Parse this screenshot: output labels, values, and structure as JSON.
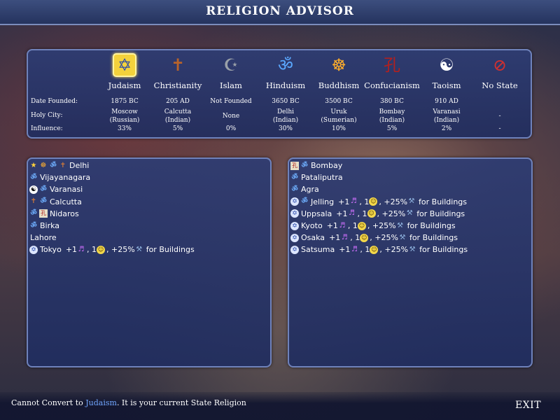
{
  "title": "RELIGION ADVISOR",
  "row_labels": {
    "date_founded": "Date Founded:",
    "holy_city": "Holy City:",
    "influence": "Influence:"
  },
  "religions": [
    {
      "name": "Judaism",
      "icon": "star-of-david-icon",
      "glyph": "✡",
      "color": "#2a4aa8",
      "date": "1875 BC",
      "holy_city_line1": "Moscow",
      "holy_city_line2": "(Russian)",
      "influence": "33%"
    },
    {
      "name": "Christianity",
      "icon": "cross-icon",
      "glyph": "✝",
      "color": "#b8632a",
      "date": "205 AD",
      "holy_city_line1": "Calcutta",
      "holy_city_line2": "(Indian)",
      "influence": "5%"
    },
    {
      "name": "Islam",
      "icon": "crescent-icon",
      "glyph": "☪",
      "color": "#9aa0a8",
      "date": "Not Founded",
      "holy_city_line1": "None",
      "holy_city_line2": "",
      "influence": "0%"
    },
    {
      "name": "Hinduism",
      "icon": "om-icon",
      "glyph": "ॐ",
      "color": "#5aa8ff",
      "date": "3650 BC",
      "holy_city_line1": "Delhi",
      "holy_city_line2": "(Indian)",
      "influence": "30%"
    },
    {
      "name": "Buddhism",
      "icon": "buddha-icon",
      "glyph": "☸",
      "color": "#ffad2a",
      "date": "3500 BC",
      "holy_city_line1": "Uruk",
      "holy_city_line2": "(Sumerian)",
      "influence": "10%"
    },
    {
      "name": "Confucianism",
      "icon": "confucian-symbol-icon",
      "glyph": "孔",
      "color": "#b02020",
      "date": "380 BC",
      "holy_city_line1": "Bombay",
      "holy_city_line2": "(Indian)",
      "influence": "5%"
    },
    {
      "name": "Taoism",
      "icon": "yin-yang-icon",
      "glyph": "☯",
      "color": "#ffffff",
      "date": "910 AD",
      "holy_city_line1": "Varanasi",
      "holy_city_line2": "(Indian)",
      "influence": "2%"
    },
    {
      "name": "No State",
      "icon": "no-state-icon",
      "glyph": "⊘",
      "color": "#d03030",
      "date": "",
      "holy_city_line1": "-",
      "holy_city_line2": "",
      "influence": "-"
    }
  ],
  "left_cities": [
    {
      "icons": [
        "star-icon",
        "buddha-icon",
        "om-icon",
        "cross-icon"
      ],
      "name": "Delhi",
      "bonus": null
    },
    {
      "icons": [
        "om-icon"
      ],
      "name": "Vijayanagara",
      "bonus": null
    },
    {
      "icons": [
        "yin-yang-icon",
        "om-icon"
      ],
      "name": "Varanasi",
      "bonus": null
    },
    {
      "icons": [
        "cross-icon",
        "om-icon"
      ],
      "name": "Calcutta",
      "bonus": null
    },
    {
      "icons": [
        "om-icon",
        "confucian-symbol-icon"
      ],
      "name": "Nidaros",
      "bonus": null
    },
    {
      "icons": [
        "om-icon"
      ],
      "name": "Birka",
      "bonus": null
    },
    {
      "icons": [],
      "name": "Lahore",
      "bonus": null
    },
    {
      "icons": [
        "star-of-david-icon"
      ],
      "name": "Tokyo",
      "bonus": {
        "prefix": "+1",
        "mid": ", 1",
        "suffix": ", +25%",
        "tail": "for Buildings"
      }
    }
  ],
  "right_cities": [
    {
      "icons": [
        "confucian-symbol-icon",
        "om-icon"
      ],
      "name": "Bombay",
      "bonus": null
    },
    {
      "icons": [
        "om-icon"
      ],
      "name": "Pataliputra",
      "bonus": null
    },
    {
      "icons": [
        "om-icon"
      ],
      "name": "Agra",
      "bonus": null
    },
    {
      "icons": [
        "star-of-david-icon",
        "om-icon"
      ],
      "name": "Jelling",
      "bonus": {
        "prefix": "+1",
        "mid": ", 1",
        "suffix": ", +25%",
        "tail": "for Buildings"
      }
    },
    {
      "icons": [
        "star-of-david-icon"
      ],
      "name": "Uppsala",
      "bonus": {
        "prefix": "+1",
        "mid": ", 1",
        "suffix": ", +25%",
        "tail": "for Buildings"
      }
    },
    {
      "icons": [
        "star-of-david-icon"
      ],
      "name": "Kyoto",
      "bonus": {
        "prefix": "+1",
        "mid": ", 1",
        "suffix": ", +25%",
        "tail": "for Buildings"
      }
    },
    {
      "icons": [
        "star-of-david-icon"
      ],
      "name": "Osaka",
      "bonus": {
        "prefix": "+1",
        "mid": ", 1",
        "suffix": ", +25%",
        "tail": "for Buildings"
      }
    },
    {
      "icons": [
        "star-of-david-icon"
      ],
      "name": "Satsuma",
      "bonus": {
        "prefix": "+1",
        "mid": ", 1",
        "suffix": ", +25%",
        "tail": "for Buildings"
      }
    }
  ],
  "status": {
    "prefix": "Cannot Convert to ",
    "religion": "Judaism",
    "suffix": ". It is your current State Religion"
  },
  "exit_label": "EXIT"
}
